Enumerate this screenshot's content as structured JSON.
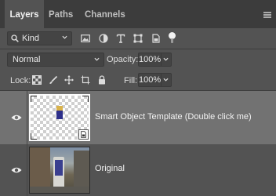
{
  "tabs": [
    {
      "label": "Layers",
      "active": true
    },
    {
      "label": "Paths",
      "active": false
    },
    {
      "label": "Channels",
      "active": false
    }
  ],
  "filter": {
    "kind_label": "Kind",
    "icons": [
      "pixel-layer-filter-icon",
      "adjustment-layer-filter-icon",
      "type-layer-filter-icon",
      "shape-layer-filter-icon",
      "smart-object-filter-icon",
      "filter-toggle-icon"
    ]
  },
  "blend": {
    "mode": "Normal",
    "opacity_label": "Opacity:",
    "opacity_value": "100%"
  },
  "lock": {
    "label": "Lock:",
    "icons": [
      "lock-transparent-pixels-icon",
      "lock-image-pixels-icon",
      "lock-position-icon",
      "lock-artboard-icon",
      "lock-all-icon"
    ],
    "fill_label": "Fill:",
    "fill_value": "100%"
  },
  "layers": [
    {
      "name": "Smart Object Template (Double click me)",
      "visible": true,
      "selected": true,
      "type": "smart-object"
    },
    {
      "name": "Original",
      "visible": true,
      "selected": false,
      "type": "image"
    }
  ],
  "colors": {
    "panel_bg": "#535353",
    "tabbar_bg": "#3c3c3c",
    "selected_row": "#727272",
    "text": "#e6e6e6"
  }
}
